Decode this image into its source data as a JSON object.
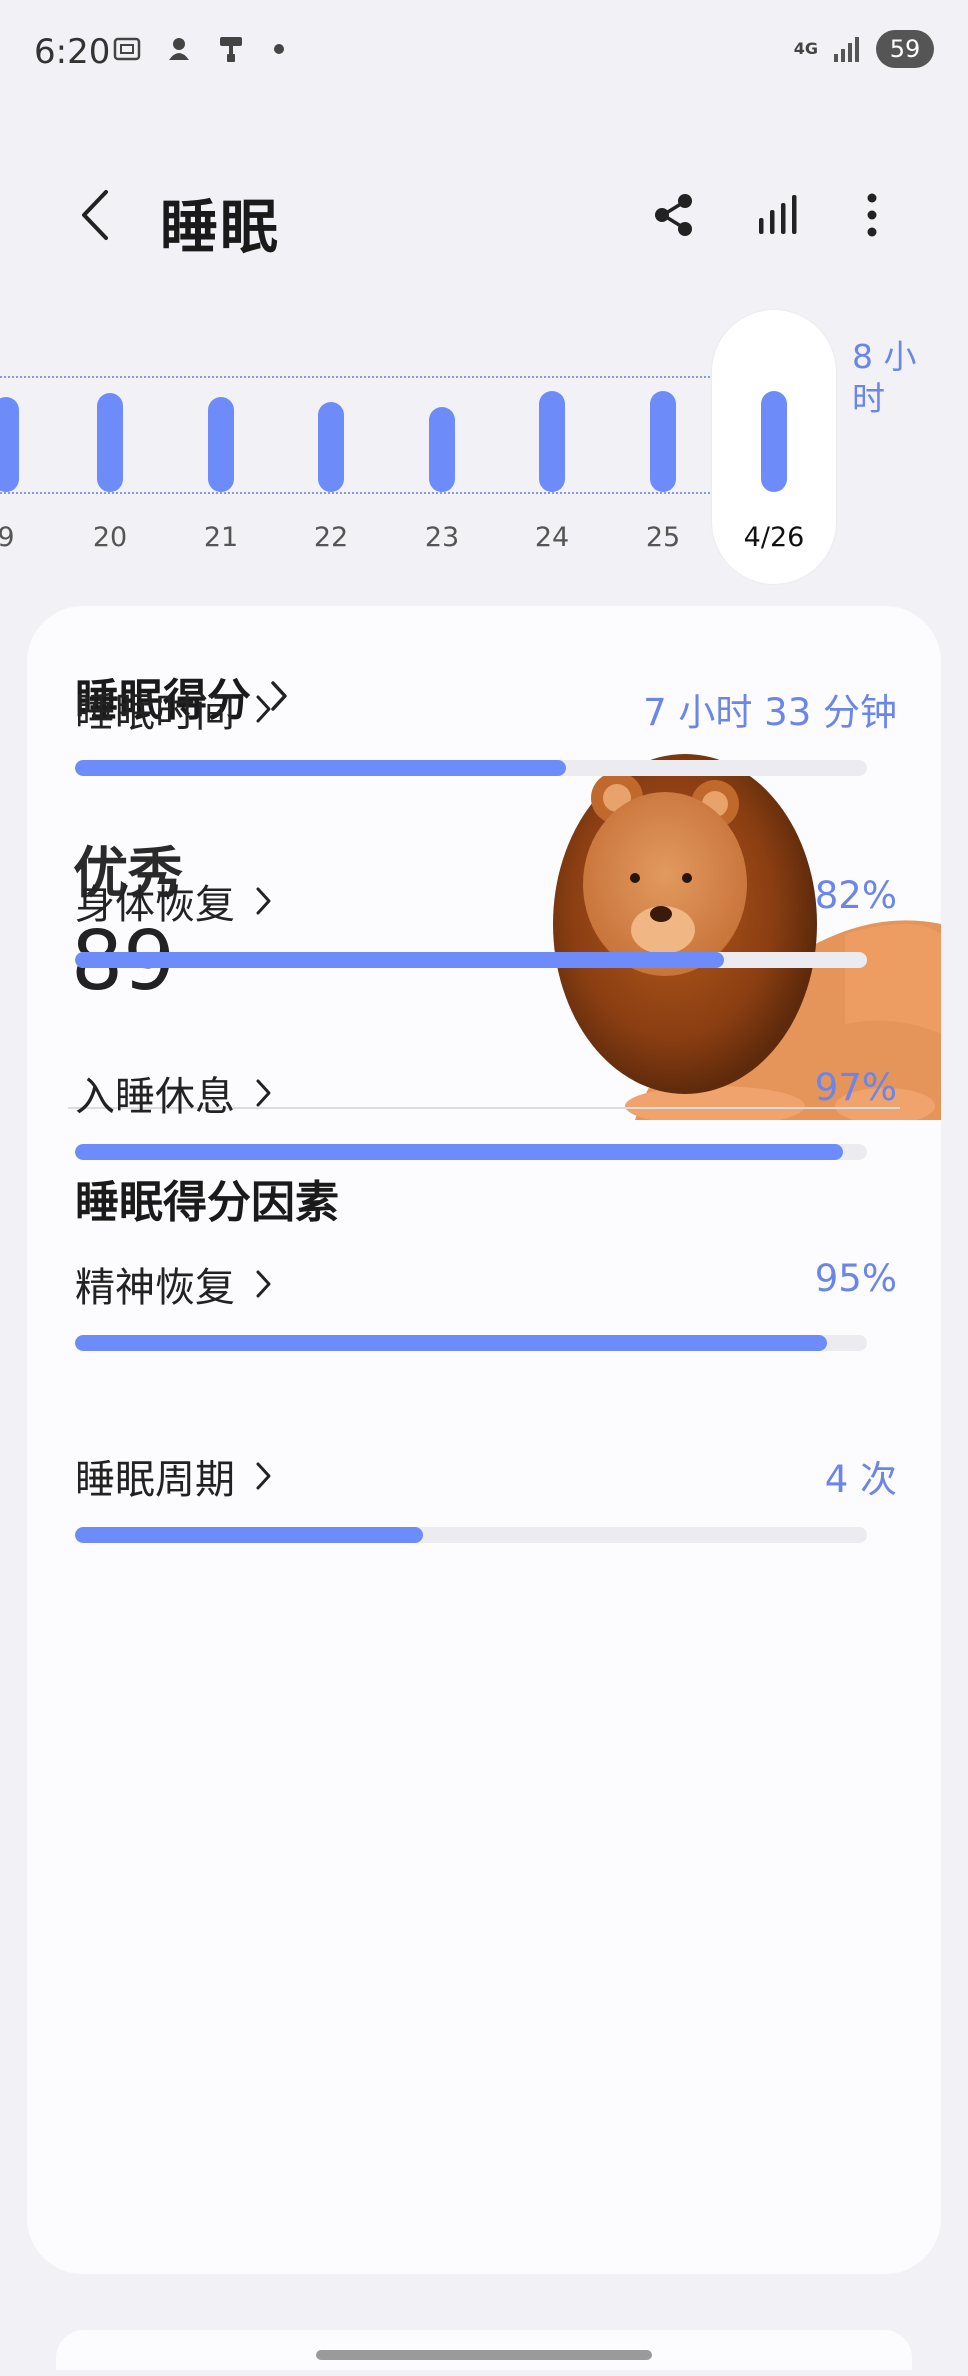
{
  "status_bar": {
    "time": "6:20",
    "network": "4G",
    "battery": "59"
  },
  "header": {
    "title": "睡眠"
  },
  "week_chart": {
    "days": [
      {
        "label": "9",
        "fraction": 0.82
      },
      {
        "label": "20",
        "fraction": 0.85
      },
      {
        "label": "21",
        "fraction": 0.82
      },
      {
        "label": "22",
        "fraction": 0.78
      },
      {
        "label": "23",
        "fraction": 0.73
      },
      {
        "label": "24",
        "fraction": 0.87
      },
      {
        "label": "25",
        "fraction": 0.87
      },
      {
        "label": "4/26",
        "fraction": 0.87,
        "selected": true
      }
    ],
    "range_label": "8 小时"
  },
  "card": {
    "score_title": "睡眠得分",
    "rating": "优秀",
    "score": "89",
    "factors_title": "睡眠得分因素",
    "factors": [
      {
        "name": "睡眠时间",
        "value": "7 小时 33 分钟",
        "fraction": 0.62
      },
      {
        "name": "身体恢复",
        "value": "82%",
        "fraction": 0.82
      },
      {
        "name": "入睡休息",
        "value": "97%",
        "fraction": 0.97
      },
      {
        "name": "精神恢复",
        "value": "95%",
        "fraction": 0.95
      },
      {
        "name": "睡眠周期",
        "value": "4 次",
        "fraction": 0.44
      }
    ]
  },
  "colors": {
    "accent": "#6e8cf9",
    "accent_text": "#6b86e8",
    "background": "#f2f2f6",
    "card": "#fcfcfe"
  }
}
